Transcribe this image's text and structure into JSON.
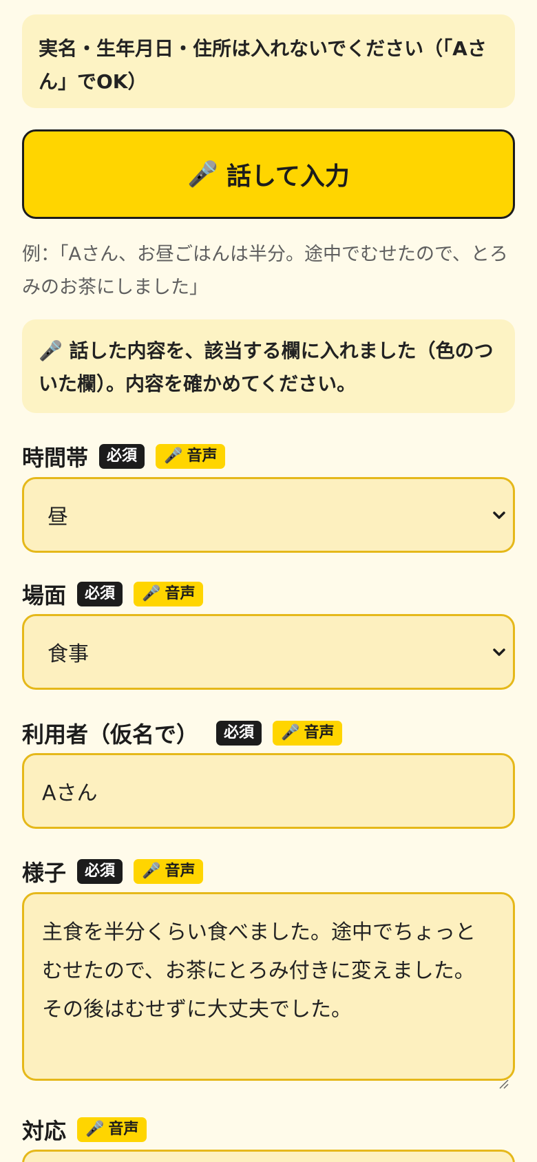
{
  "notice": {
    "text": "実名・生年月日・住所は入れないでください（「Aさん」でOK）"
  },
  "voice_button": {
    "icon": "🎤",
    "label": "話して入力"
  },
  "example": {
    "text": "例：「Aさん、お昼ごはんは半分。途中でむせたので、とろみのお茶にしました」"
  },
  "info": {
    "icon": "🎤",
    "text": "話した内容を、該当する欄に入れました（色のついた欄）。内容を確かめてください。"
  },
  "badges": {
    "required": "必須",
    "voice_icon": "🎤",
    "voice": "音声"
  },
  "fields": {
    "time": {
      "label": "時間帯",
      "value": "昼"
    },
    "scene": {
      "label": "場面",
      "value": "食事"
    },
    "user": {
      "label": "利用者（仮名で）",
      "value": "Aさん"
    },
    "state": {
      "label": "様子",
      "value": "主食を半分くらい食べました。途中でちょっとむせたので、お茶にとろみ付きに変えました。その後はむせずに大丈夫でした。"
    },
    "response": {
      "label": "対応"
    }
  },
  "colors": {
    "accent": "#ffd500",
    "field_bg": "#fdf0bf",
    "field_border": "#e5b81a",
    "page_bg": "#fffbea"
  }
}
